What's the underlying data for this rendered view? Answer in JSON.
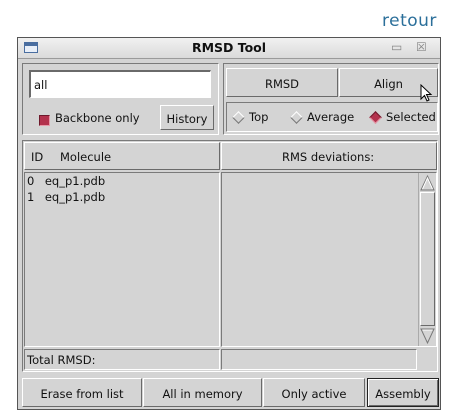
{
  "overlay_link": "retour",
  "window": {
    "title": "RMSD Tool",
    "minimize_glyph": "▭",
    "close_glyph": "☒"
  },
  "selection": {
    "value": "all"
  },
  "backbone": {
    "label": "Backbone only",
    "checked": true
  },
  "buttons": {
    "history": "History",
    "rmsd": "RMSD",
    "align": "Align"
  },
  "modes": {
    "selected": "Selected",
    "options": [
      "Top",
      "Average",
      "Selected"
    ]
  },
  "table": {
    "col_id": "ID",
    "col_molecule": "Molecule",
    "col_rms": "RMS deviations:",
    "rows": [
      {
        "id": "0",
        "molecule": "eq_p1.pdb"
      },
      {
        "id": "1",
        "molecule": "eq_p1.pdb"
      }
    ],
    "total_label": "Total RMSD:",
    "total_value": ""
  },
  "bottom_buttons": {
    "erase": "Erase from list",
    "all_in_memory": "All in memory",
    "only_active": "Only active",
    "assembly": "Assembly"
  },
  "colors": {
    "accent": "#b3324d",
    "link": "#2b6f9a",
    "face": "#d4d4d4"
  },
  "icons": [
    "window-icon",
    "minimize-icon",
    "close-icon",
    "mouse-cursor-icon",
    "scroll-up-arrow-icon",
    "scroll-down-arrow-icon"
  ]
}
